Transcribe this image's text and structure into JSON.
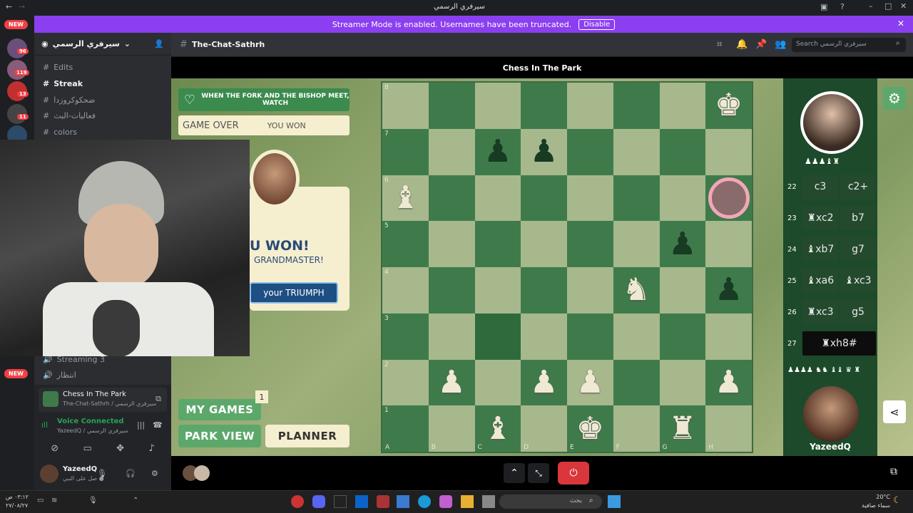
{
  "window": {
    "title": "سيرفري الرسمي"
  },
  "banner": {
    "text": "Streamer Mode is enabled. Usernames have been truncated.",
    "disable_label": "Disable",
    "new_label": "NEW"
  },
  "servers": {
    "badges": [
      "96",
      "119",
      "13",
      "11"
    ],
    "new_label": "NEW"
  },
  "sidebar": {
    "server_name": "سيرفري الرسمي",
    "channels": [
      {
        "label": "Edits"
      },
      {
        "label": "Streak"
      },
      {
        "label": "ضحكوكروزدا"
      },
      {
        "label": "فعاليات-البث"
      },
      {
        "label": "colors"
      }
    ],
    "voice_channels": [
      {
        "label": "Streaming 3"
      },
      {
        "label": "انتظار"
      }
    ]
  },
  "activity": {
    "title": "Chess In The Park",
    "subtitle": "The-Chat-Sathrh / سيرفري الرسمي"
  },
  "voice": {
    "status": "Voice Connected",
    "detail": "YazeedQ / سيرفري الرسمي"
  },
  "user": {
    "name": "YazeedQ",
    "status": "صل على النبي ●"
  },
  "chat": {
    "channel_name": "The-Chat-Sathrh",
    "search_placeholder": "Search سيرفري الرسمي"
  },
  "stage": {
    "title": "Chess In The Park"
  },
  "game": {
    "fork_text": "WHEN THE FORK AND THE BISHOP MEET, WATCH",
    "game_over": "GAME OVER",
    "you_won_small": "YOU WON",
    "you_won_big": "U WON!",
    "grandmaster": "GRANDMASTER!",
    "triumph": "your TRIUMPH",
    "my_games": "MY GAMES",
    "my_games_count": "1",
    "park_view": "PARK VIEW",
    "planner": "PLANNER",
    "opponent_captures": "♟♟♟♝♜",
    "player_captures": "♟♟♟♟ ♞♞ ♝♝ ♛ ♜",
    "player_name": "YazeedQ"
  },
  "moves": [
    {
      "num": "22",
      "white": "c3",
      "black": "c2+"
    },
    {
      "num": "23",
      "white": "♜xc2",
      "black": "b7"
    },
    {
      "num": "24",
      "white": "♝xb7",
      "black": "g7"
    },
    {
      "num": "25",
      "white": "♝xa6",
      "black": "♝xc3"
    },
    {
      "num": "26",
      "white": "♜xc3",
      "black": "g5"
    },
    {
      "num": "27",
      "white": "♜xh8#",
      "black": ""
    }
  ],
  "board": {
    "ranks": [
      "8",
      "7",
      "6",
      "5",
      "4",
      "3",
      "2",
      "1"
    ],
    "files": [
      "A",
      "B",
      "C",
      "D",
      "E",
      "F",
      "G",
      "H"
    ],
    "pieces": {
      "0-7": "wk-black-mark",
      "1-2": "bp",
      "1-3": "bp",
      "2-0": "wb",
      "2-7": "bk-ring",
      "3-6": "bp",
      "4-5": "wn",
      "4-7": "bp",
      "6-1": "wp",
      "6-3": "wp",
      "6-4": "wp",
      "6-7": "wp",
      "7-2": "wb",
      "7-4": "wk",
      "7-6": "wr"
    }
  },
  "taskbar": {
    "time": "٠٣:١٢ ص",
    "date": "٢٧/٠٨/٢٧",
    "weather_temp": "20°C",
    "weather_text": "سماء صافية",
    "search_placeholder": "بحث"
  },
  "colors": {
    "accent": "#8b3ff0",
    "board_dark": "#3f7b4a",
    "board_light": "#a7b88d",
    "danger": "#da373c"
  }
}
